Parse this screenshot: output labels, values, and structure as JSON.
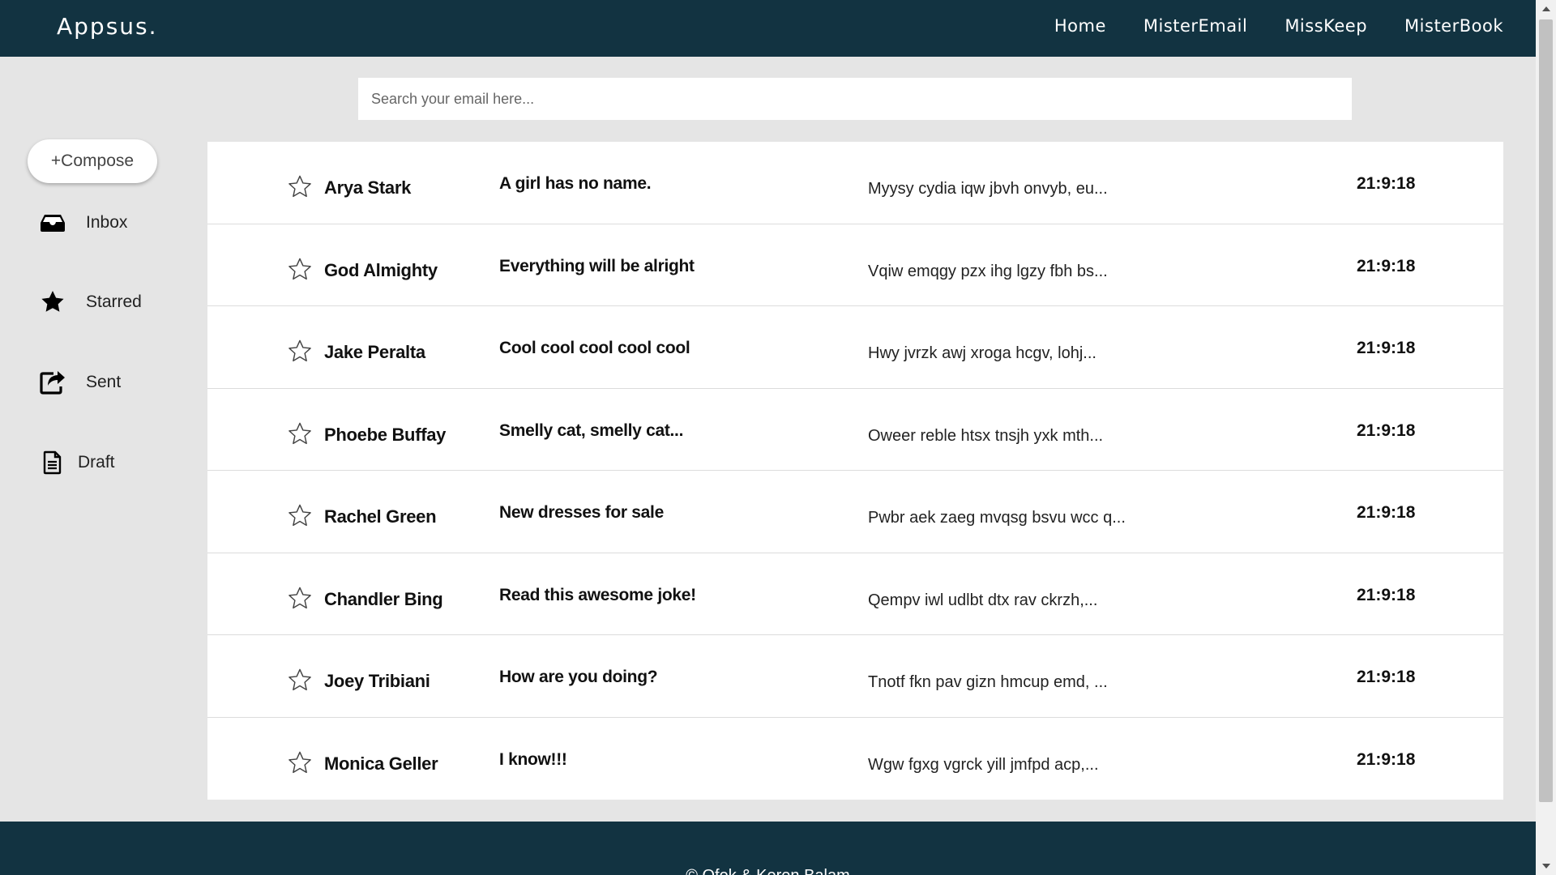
{
  "header": {
    "logo": "Appsus.",
    "nav": [
      {
        "label": "Home"
      },
      {
        "label": "MisterEmail"
      },
      {
        "label": "MissKeep"
      },
      {
        "label": "MisterBook"
      }
    ]
  },
  "search": {
    "placeholder": "Search your email here..."
  },
  "sidebar": {
    "compose_label": "+Compose",
    "items": [
      {
        "label": "Inbox",
        "icon": "inbox-icon"
      },
      {
        "label": "Starred",
        "icon": "star-icon"
      },
      {
        "label": "Sent",
        "icon": "share-icon"
      },
      {
        "label": "Draft",
        "icon": "file-icon"
      }
    ]
  },
  "emails": [
    {
      "from": "Arya Stark",
      "subject": "A girl has no name.",
      "preview": "Myysy cydia iqw jbvh onvyb, eu...",
      "time": "21:9:18"
    },
    {
      "from": "God Almighty",
      "subject": "Everything will be alright",
      "preview": "Vqiw emqgy pzx ihg lgzy fbh bs...",
      "time": "21:9:18"
    },
    {
      "from": "Jake Peralta",
      "subject": "Cool cool cool cool cool",
      "preview": "Hwy jvrzk awj xroga hcgv, lohj...",
      "time": "21:9:18"
    },
    {
      "from": "Phoebe Buffay",
      "subject": "Smelly cat, smelly cat...",
      "preview": "Oweer reble htsx tnsjh yxk mth...",
      "time": "21:9:18"
    },
    {
      "from": "Rachel Green",
      "subject": "New dresses for sale",
      "preview": "Pwbr aek zaeg mvqsg bsvu wcc q...",
      "time": "21:9:18"
    },
    {
      "from": "Chandler Bing",
      "subject": "Read this awesome joke!",
      "preview": "Qempv iwl udlbt dtx rav ckrzh,...",
      "time": "21:9:18"
    },
    {
      "from": "Joey Tribiani",
      "subject": "How are you doing?",
      "preview": "Tnotf fkn pav gizn hmcup emd, ...",
      "time": "21:9:18"
    },
    {
      "from": "Monica Geller",
      "subject": "I know!!!",
      "preview": "Wgw fgxg vgrck yill jmfpd acp,...",
      "time": "21:9:18"
    }
  ],
  "footer": {
    "text": "© Ofek & Keren Balam"
  },
  "colors": {
    "header_bg": "#123341",
    "page_bg": "#e5e5e5"
  }
}
